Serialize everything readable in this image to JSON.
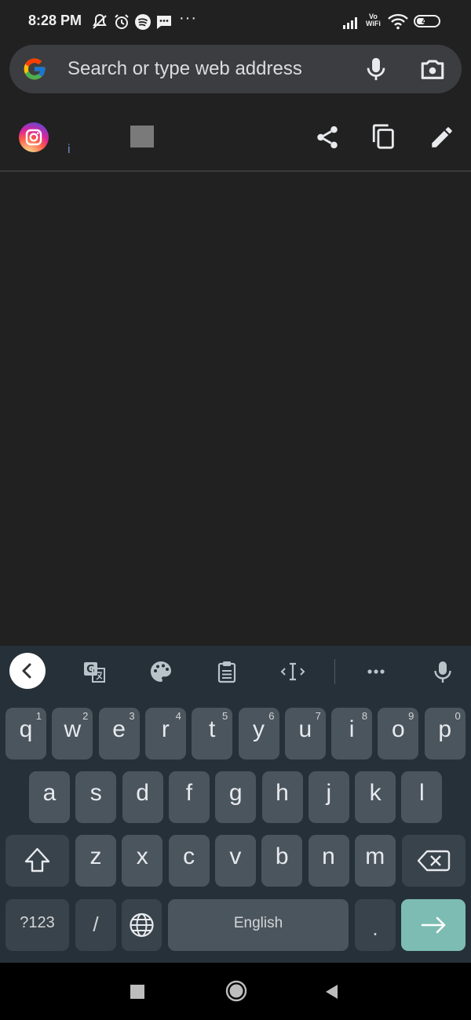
{
  "status_bar": {
    "time": "8:28 PM",
    "icons": [
      "bell-off-icon",
      "alarm-icon",
      "spotify-icon",
      "message-icon"
    ],
    "more": "···",
    "volte_top": "Vo",
    "volte_bottom": "WiFi",
    "battery": "40"
  },
  "search": {
    "placeholder": "Search or type web address"
  },
  "clip_row": {
    "snippet": "i",
    "actions": [
      "share-icon",
      "copy-icon",
      "edit-icon"
    ]
  },
  "keyboard": {
    "row1": [
      {
        "key": "q",
        "hint": "1"
      },
      {
        "key": "w",
        "hint": "2"
      },
      {
        "key": "e",
        "hint": "3"
      },
      {
        "key": "r",
        "hint": "4"
      },
      {
        "key": "t",
        "hint": "5"
      },
      {
        "key": "y",
        "hint": "6"
      },
      {
        "key": "u",
        "hint": "7"
      },
      {
        "key": "i",
        "hint": "8"
      },
      {
        "key": "o",
        "hint": "9"
      },
      {
        "key": "p",
        "hint": "0"
      }
    ],
    "row2": [
      "a",
      "s",
      "d",
      "f",
      "g",
      "h",
      "j",
      "k",
      "l"
    ],
    "row3": [
      "z",
      "x",
      "c",
      "v",
      "b",
      "n",
      "m"
    ],
    "symbols_label": "?123",
    "slash_label": "/",
    "space_label": "English",
    "period_label": ".",
    "colors": {
      "background": "#263038",
      "key": "#4a555e",
      "enter": "#7cbcb3"
    }
  }
}
